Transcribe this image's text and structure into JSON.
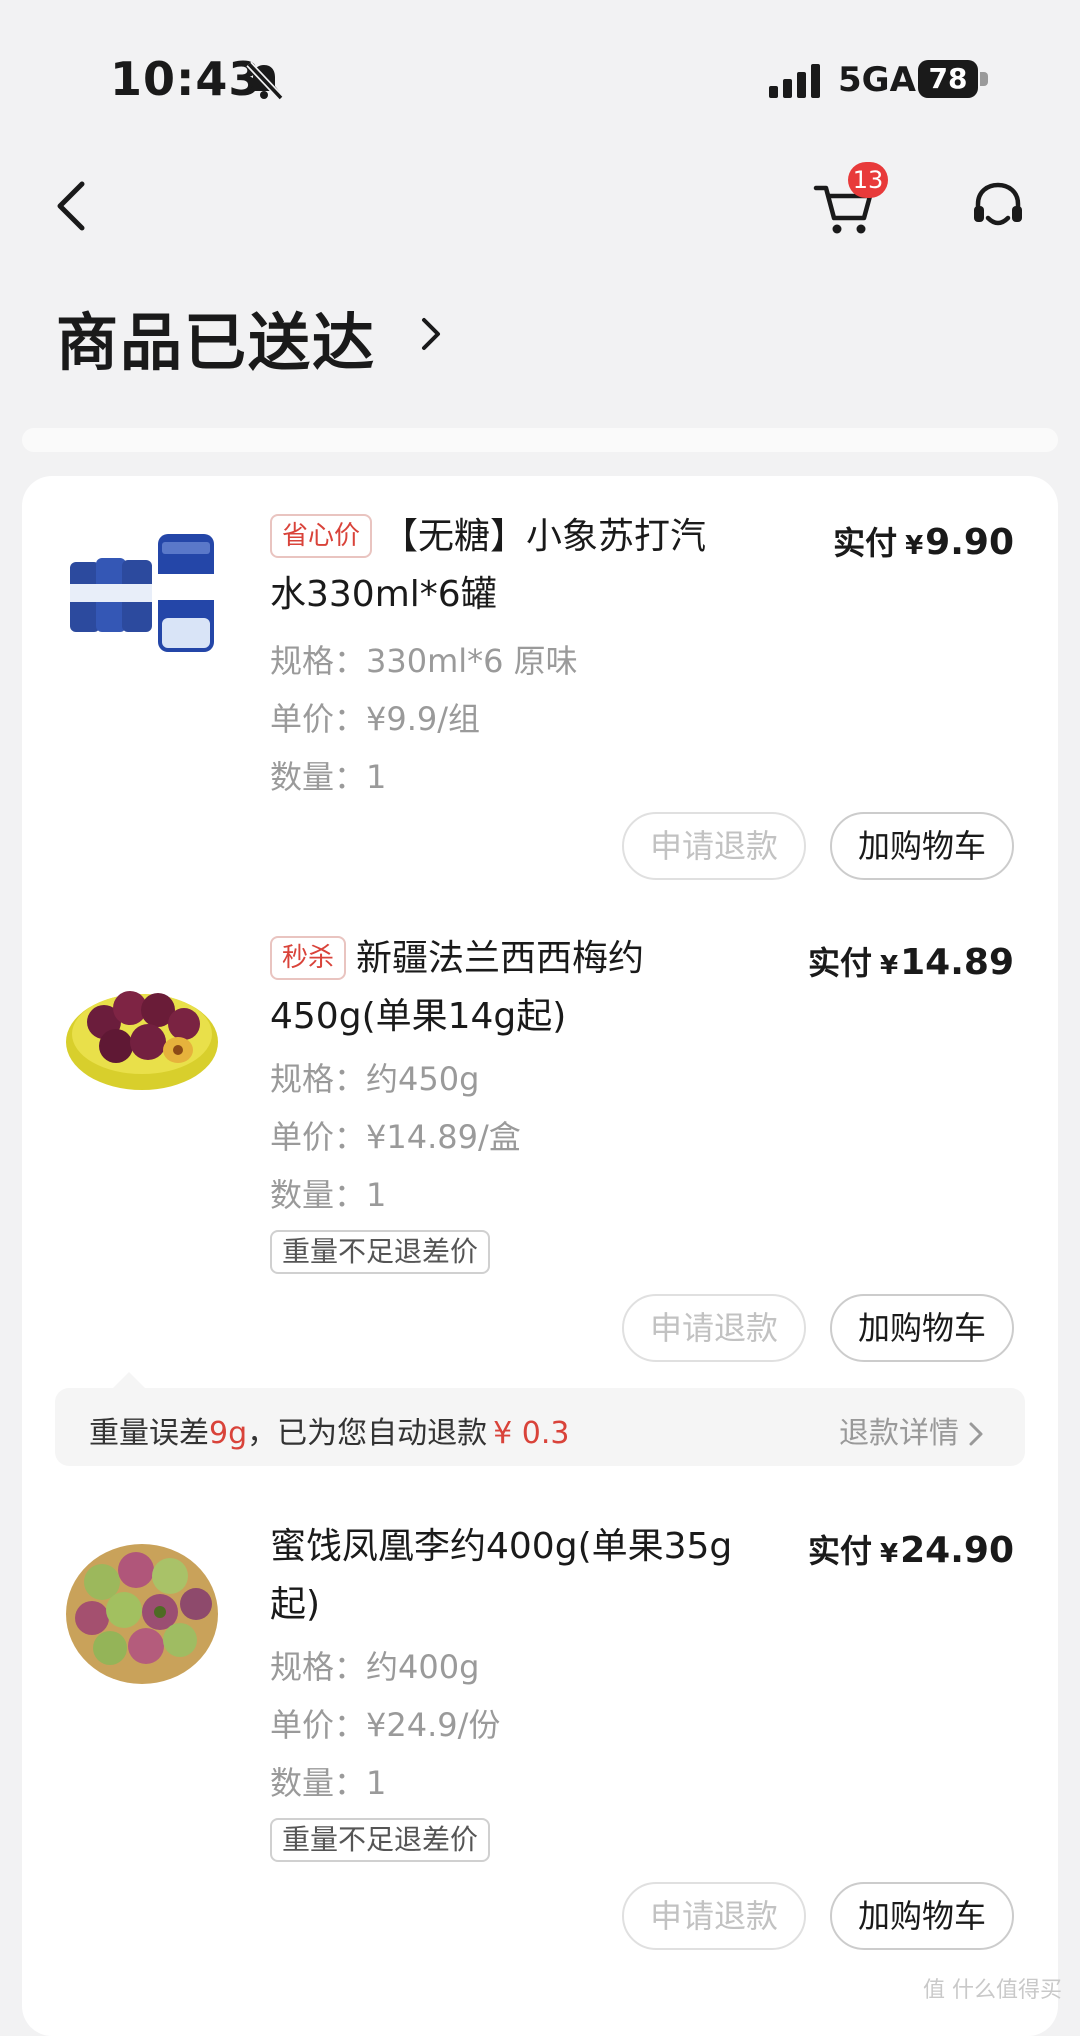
{
  "status_bar": {
    "time": "10:43",
    "network": "5GA",
    "battery": "78"
  },
  "nav": {
    "cart_badge": "13"
  },
  "page_title": "商品已送达",
  "items": [
    {
      "tag": "省心价",
      "title": "【无糖】小象苏打汽水330ml*6罐",
      "paid_label": "实付",
      "currency": "¥",
      "paid_amount": "9.90",
      "spec": "规格：330ml*6 原味",
      "unit_price": "单价：¥9.9/组",
      "quantity": "数量：1",
      "refund_button": "申请退款",
      "add_cart_button": "加购物车"
    },
    {
      "tag": "秒杀",
      "title": "新疆法兰西西梅约450g(单果14g起)",
      "paid_label": "实付",
      "currency": "¥",
      "paid_amount": "14.89",
      "spec": "规格：约450g",
      "unit_price": "单价：¥14.89/盒",
      "quantity": "数量：1",
      "weight_note": "重量不足退差价",
      "refund_button": "申请退款",
      "add_cart_button": "加购物车"
    },
    {
      "title": "蜜饯凤凰李约400g(单果35g起)",
      "paid_label": "实付",
      "currency": "¥",
      "paid_amount": "24.90",
      "spec": "规格：约400g",
      "unit_price": "单价：¥24.9/份",
      "quantity": "数量：1",
      "weight_note": "重量不足退差价",
      "refund_button": "申请退款",
      "add_cart_button": "加购物车"
    }
  ],
  "refund_notice": {
    "prefix": "重量误差",
    "weight": "9g",
    "middle": "，已为您自动退款",
    "amount": "¥ 0.3",
    "detail_link": "退款详情"
  },
  "watermark": "值 什么值得买",
  "colors": {
    "accent_red": "#d9433a",
    "badge_red": "#e83a3a",
    "background": "#f2f2f3"
  }
}
